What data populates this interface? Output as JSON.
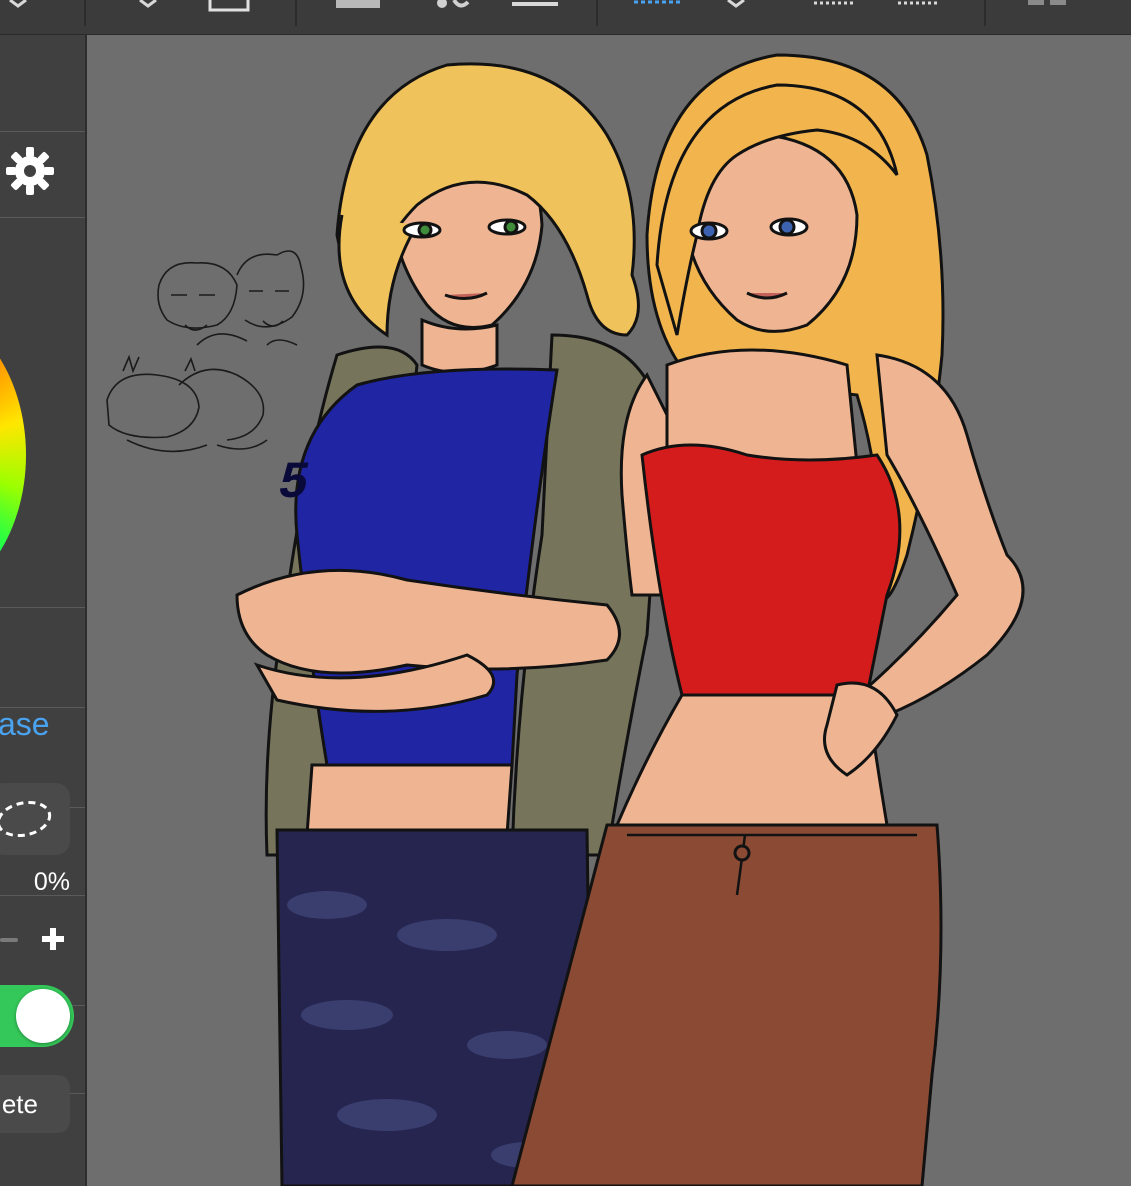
{
  "toolbar": {
    "icons": [
      "dropdown-icon",
      "rectangle-icon",
      "fill-shape-icon",
      "brush-icon",
      "layer-bar-icon",
      "ruler-icon",
      "dropdown-icon",
      "guide-icon",
      "guide-icon",
      "layout-icon"
    ]
  },
  "side_panel": {
    "settings_icon": "gear-icon",
    "release_label": "ase",
    "lasso_icon": "lasso-icon",
    "opacity_value": "0%",
    "plus_icon": "plus-icon",
    "toggle_state": "on",
    "delete_label": "ete"
  },
  "canvas": {
    "artwork": "illustration",
    "shirt_number": "5"
  },
  "colors": {
    "toolbar": "#3b3b3b",
    "panel": "#404040",
    "canvas": "#6e6e6e",
    "accent_blue": "#4aa3f0",
    "toggle_green": "#34c759"
  }
}
